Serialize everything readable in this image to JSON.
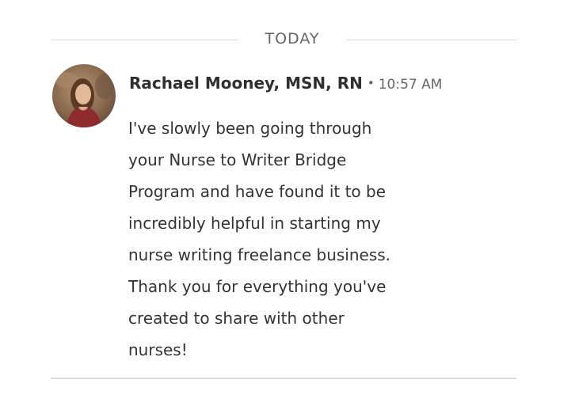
{
  "divider": {
    "label": "TODAY"
  },
  "message": {
    "author": "Rachael Mooney, MSN, RN",
    "separator": "•",
    "time": "10:57 AM",
    "lines": [
      "I've slowly been going through",
      "your Nurse to Writer Bridge",
      "Program and have found it to be",
      "incredibly helpful in starting my",
      "nurse writing freelance business.",
      "Thank you for everything you've",
      "created to share with other",
      "nurses!"
    ]
  },
  "colors": {
    "divider_rule": "#d6d6d6",
    "meta_text": "#666666",
    "body_text": "#333333",
    "avatar_background": "#8a6a4e",
    "avatar_sweater": "#8e2b2f"
  }
}
